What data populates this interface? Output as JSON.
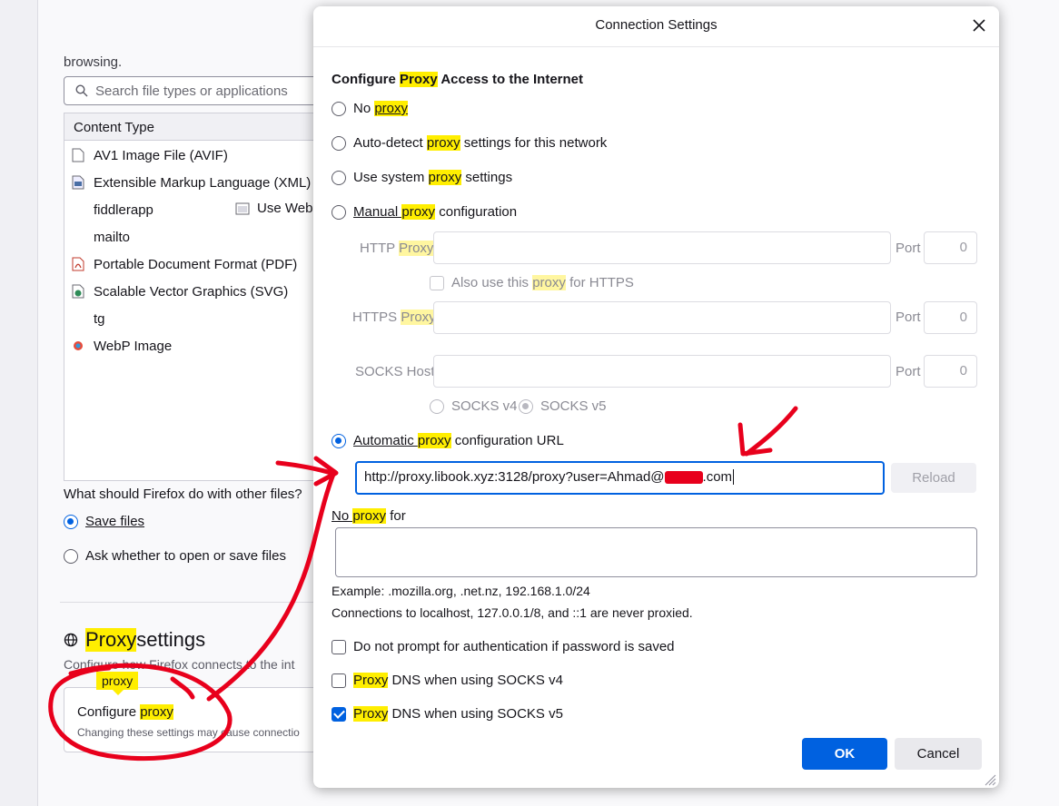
{
  "background": {
    "browsing_text": "browsing.",
    "search_placeholder": "Search file types or applications",
    "table_header": "Content Type",
    "rows": [
      "AV1 Image File (AVIF)",
      "Extensible Markup Language (XML)",
      "fiddlerapp",
      "mailto",
      "Portable Document Format (PDF)",
      "Scalable Vector Graphics (SVG)",
      "tg",
      "WebP Image"
    ],
    "use_web_label": "Use Web",
    "other_files_question": "What should Firefox do with other files?",
    "save_files": "Save files",
    "ask_files": "Ask whether to open or save files",
    "proxy_heading_word": "Proxy",
    "proxy_heading_rest": " settings",
    "proxy_desc": "Configure how Firefox connects to the int",
    "proxy_tag": "proxy",
    "configure_word": "Configure ",
    "configure_hl": "proxy",
    "changing_text": "Changing these settings may cause connectio"
  },
  "dialog": {
    "title": "Connection Settings",
    "section": {
      "pre": "Configure ",
      "hl": "Proxy",
      "post": " Access to the Internet"
    },
    "options": {
      "no_proxy": {
        "pre": "No ",
        "hl": "proxy"
      },
      "auto_detect": {
        "pre": "Auto-detect ",
        "hl": "proxy",
        "post": " settings for this network"
      },
      "system": {
        "pre": "Use system ",
        "hl": "proxy",
        "post": " settings"
      },
      "manual": {
        "pre": "Manual ",
        "hl": "proxy",
        "post": " configuration"
      },
      "automatic": {
        "pre": "Automatic ",
        "hl": "proxy",
        "post": " configuration URL"
      }
    },
    "http_proxy": {
      "pre": "HTTP ",
      "hl": "Proxy"
    },
    "port_label": "Port",
    "port_value": "0",
    "also_https": {
      "pre": "Also use this ",
      "hl": "proxy",
      "post": " for HTTPS"
    },
    "https_proxy": {
      "pre": "HTTPS ",
      "hl": "Proxy"
    },
    "socks_host": "SOCKS Host",
    "socks_v4": "SOCKS v4",
    "socks_v5": "SOCKS v5",
    "pac_url": "http://proxy.libook.xyz:3128/proxy?user=Ahmad@",
    "pac_url_tail": ".com",
    "reload": "Reload",
    "no_proxy_for": {
      "pre": "No ",
      "hl": "proxy",
      "post": " for"
    },
    "example": "Example: .mozilla.org, .net.nz, 192.168.1.0/24",
    "localhost_note": "Connections to localhost, 127.0.0.1/8, and ::1 are never proxied.",
    "no_prompt": "Do not prompt for authentication if password is saved",
    "dns_v4": {
      "hl": "Proxy",
      "post": " DNS when using SOCKS v4"
    },
    "dns_v5": {
      "hl": "Proxy",
      "post": " DNS when using SOCKS v5"
    },
    "ok": "OK",
    "cancel": "Cancel"
  },
  "colors": {
    "accent": "#0061e0",
    "highlight": "#ffee00",
    "annotation": "#e8001c"
  },
  "icons": [
    "search-icon",
    "file-icon",
    "xml-icon",
    "pdf-icon",
    "svg-icon",
    "webp-icon",
    "globe-icon",
    "close-icon",
    "resize-grip-icon"
  ]
}
